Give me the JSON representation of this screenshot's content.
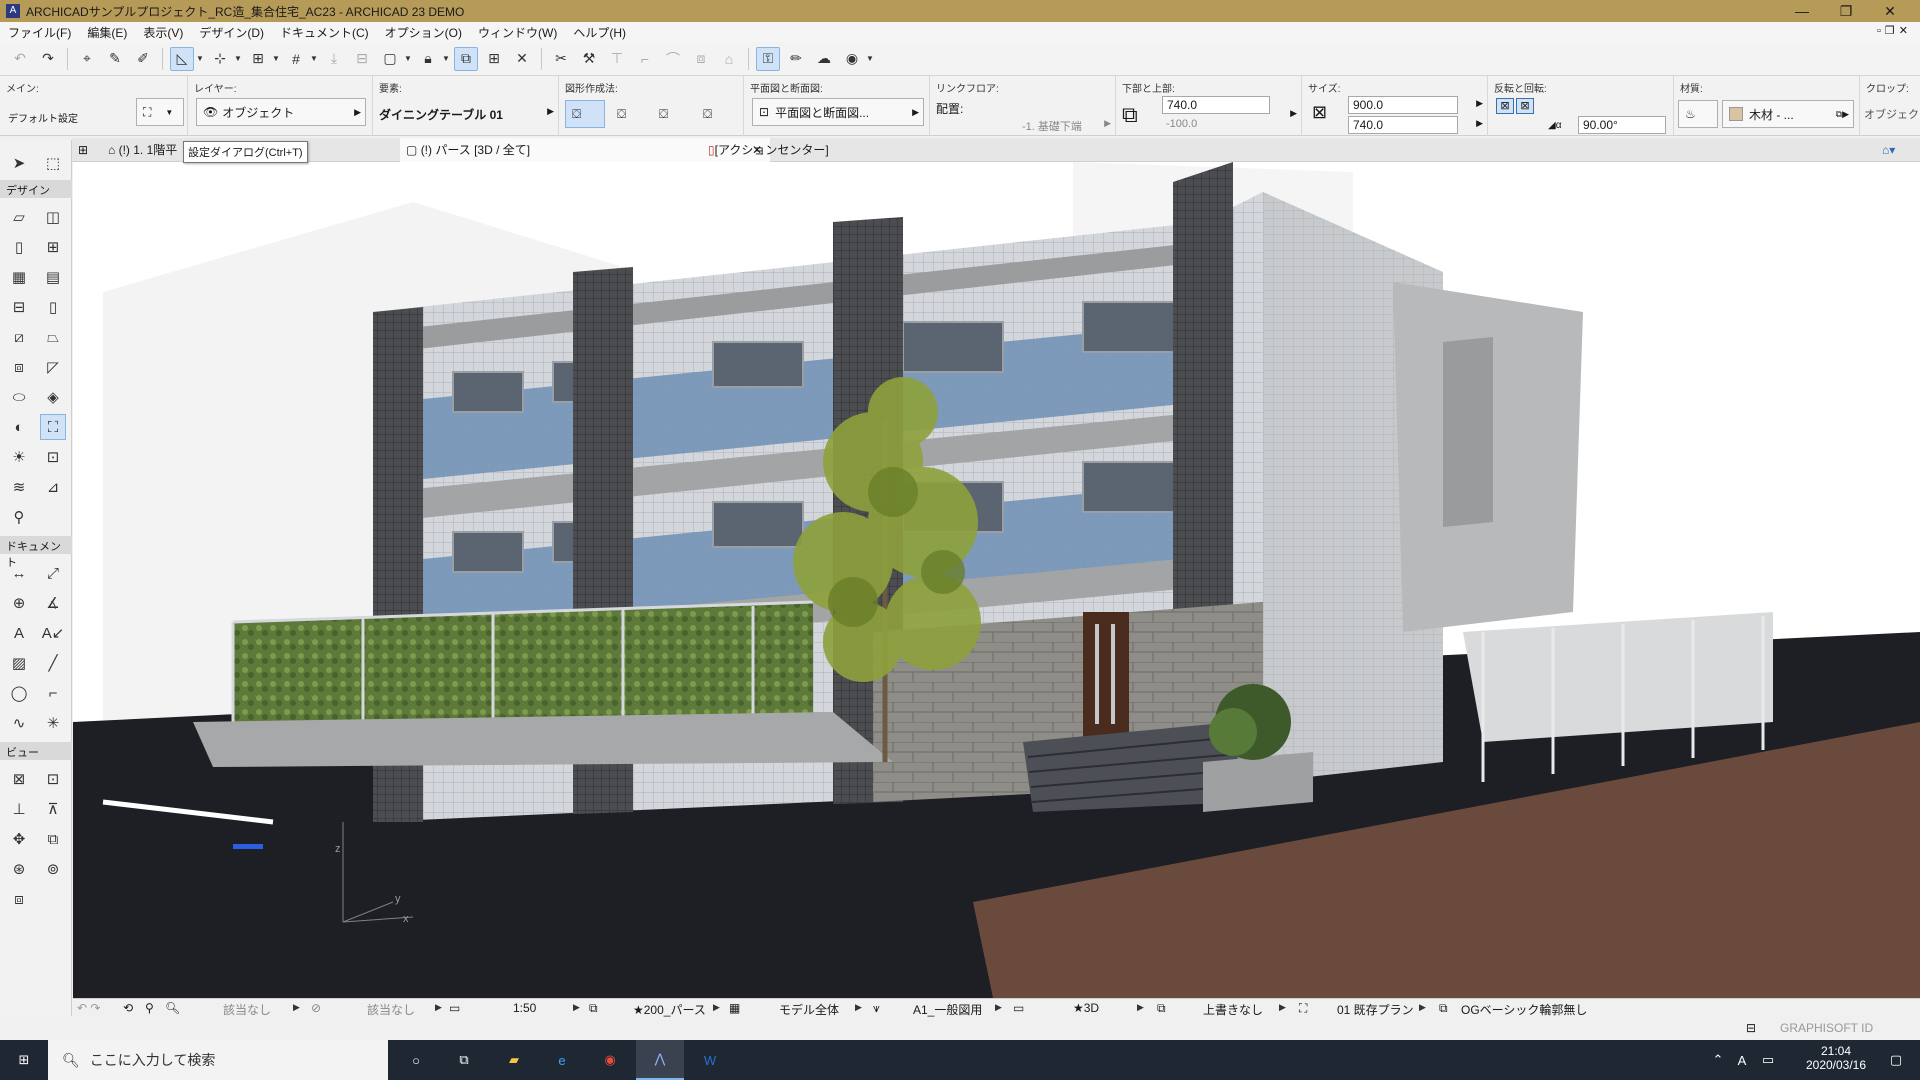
{
  "window": {
    "title": "ARCHICADサンプルプロジェクト_RC造_集合住宅_AC23 - ARCHICAD 23 DEMO",
    "minimize": "—",
    "maximize": "❐",
    "close": "✕"
  },
  "menu": [
    "ファイル(F)",
    "編集(E)",
    "表示(V)",
    "デザイン(D)",
    "ドキュメント(C)",
    "オプション(O)",
    "ウィンドウ(W)",
    "ヘルプ(H)"
  ],
  "infobox": {
    "main_label": "メイン:",
    "default_settings": "デフォルト設定",
    "layer_label": "レイヤー:",
    "layer_value": "オブジェクト",
    "element_label": "要素:",
    "element_value": "ダイニングテーブル 01",
    "geometry_label": "図形作成法:",
    "plan_section_label": "平面図と断面図:",
    "plan_section_value": "平面図と断面図...",
    "link_floor_label": "リンクフロア:",
    "placement_label": "配置:",
    "placement_value": "-1. 基礎下端",
    "bottom_top_label": "下部と上部:",
    "top_value": "740.0",
    "bottom_value": "-100.0",
    "size_label": "サイズ:",
    "size_x": "900.0",
    "size_y": "740.0",
    "mirror_label": "反転と回転:",
    "angle_value": "90.00°",
    "material_label": "材質:",
    "material_value": "木材 - ...",
    "crop_label": "クロップ:",
    "crop_value": "オブジェクト"
  },
  "toolbox": {
    "design_head": "デザイン",
    "document_head": "ドキュメント",
    "view_head": "ビュー"
  },
  "tabs": {
    "floor_plan": "(!) 1. 1階平",
    "perspective": "(!) パース [3D / 全て]",
    "perspective_close": "✕",
    "action_center": "[アクションセンター]"
  },
  "tooltip": "設定ダイアログ(Ctrl+T)",
  "statusbar": {
    "undo_na": "該当なし",
    "redo_na": "該当なし",
    "scale": "1:50",
    "pen_set": "★200_パース",
    "model_view": "モデル全体",
    "dimension": "A1_一般図用",
    "view_3d": "★3D",
    "override": "上書きなし",
    "renovation": "01 既存プラン",
    "structure": "OGベーシック輪郭無し",
    "graphisoft_id": "GRAPHISOFT ID"
  },
  "taskbar": {
    "search_placeholder": "ここに入力して検索",
    "time": "21:04",
    "date": "2020/03/16",
    "ime": "A"
  },
  "viewport_axes": {
    "x": "x",
    "y": "y",
    "z": "z"
  },
  "colors": {
    "titlebar": "#b59b57",
    "accent": "#cfe2f7",
    "taskbar": "#1f2733"
  }
}
